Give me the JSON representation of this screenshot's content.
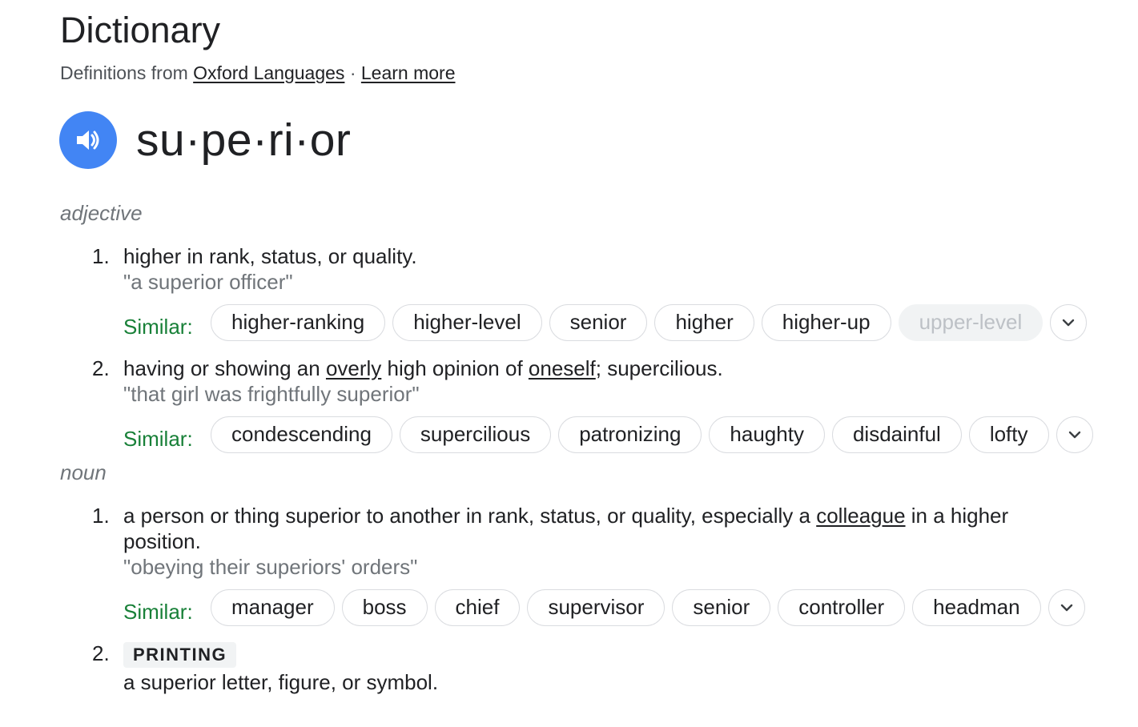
{
  "header": {
    "title": "Dictionary",
    "source_prefix": "Definitions from",
    "source_link": "Oxford Languages",
    "separator": "·",
    "learn_more": "Learn more"
  },
  "entry": {
    "word": "su·pe·ri·or",
    "speaker_icon": "speaker-icon",
    "accent_color": "#4285f4",
    "similar_color": "#188038"
  },
  "adjective": {
    "pos": "adjective",
    "senses": [
      {
        "number": "1.",
        "definition": "higher in rank, status, or quality.",
        "example": "\"a superior officer\"",
        "similar_label": "Similar:",
        "similar": [
          "higher-ranking",
          "higher-level",
          "senior",
          "higher",
          "higher-up",
          "upper-level"
        ]
      },
      {
        "number": "2.",
        "def_part1": "having or showing an ",
        "def_link1": "overly",
        "def_part2": " high opinion of ",
        "def_link2": "oneself",
        "def_part3": "; supercilious.",
        "example": "\"that girl was frightfully superior\"",
        "similar_label": "Similar:",
        "similar": [
          "condescending",
          "supercilious",
          "patronizing",
          "haughty",
          "disdainful",
          "lofty"
        ]
      }
    ]
  },
  "noun": {
    "pos": "noun",
    "senses": [
      {
        "number": "1.",
        "def_part1": "a person or thing superior to another in rank, status, or quality, especially a ",
        "def_link1": "colleague",
        "def_part2": " in a higher position.",
        "example": "\"obeying their superiors' orders\"",
        "similar_label": "Similar:",
        "similar": [
          "manager",
          "boss",
          "chief",
          "supervisor",
          "senior",
          "controller",
          "headman"
        ]
      },
      {
        "number": "2.",
        "label": "PRINTING",
        "definition": "a superior letter, figure, or symbol."
      }
    ]
  }
}
